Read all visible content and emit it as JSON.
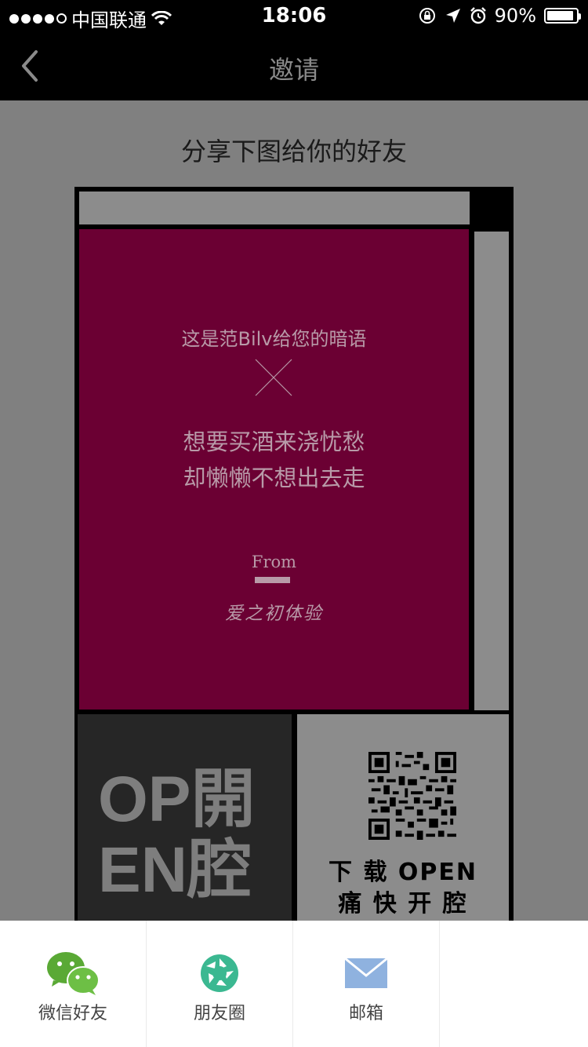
{
  "status": {
    "carrier": "中国联通",
    "time": "18:06",
    "battery": "90%",
    "battery_level": 0.9,
    "signal_dots": [
      1,
      1,
      1,
      1,
      0
    ]
  },
  "nav": {
    "title": "邀请"
  },
  "page": {
    "subtitle": "分享下图给你的好友"
  },
  "card": {
    "intro": "这是范Bilv给您的暗语",
    "poem_line1": "想要买酒来浇忧愁",
    "poem_line2": "却懒懒不想出去走",
    "from_label": "From",
    "brand": "爱之初体验",
    "logo_line1": "OP開",
    "logo_line2": "EN腔",
    "download_line1": "下 载 OPEN",
    "download_line2": "痛 快 开 腔"
  },
  "share": {
    "items": [
      {
        "label": "微信好友",
        "icon": "wechat-icon"
      },
      {
        "label": "朋友圈",
        "icon": "moments-icon"
      },
      {
        "label": "邮箱",
        "icon": "mail-icon"
      },
      {
        "label": "",
        "icon": ""
      }
    ]
  }
}
